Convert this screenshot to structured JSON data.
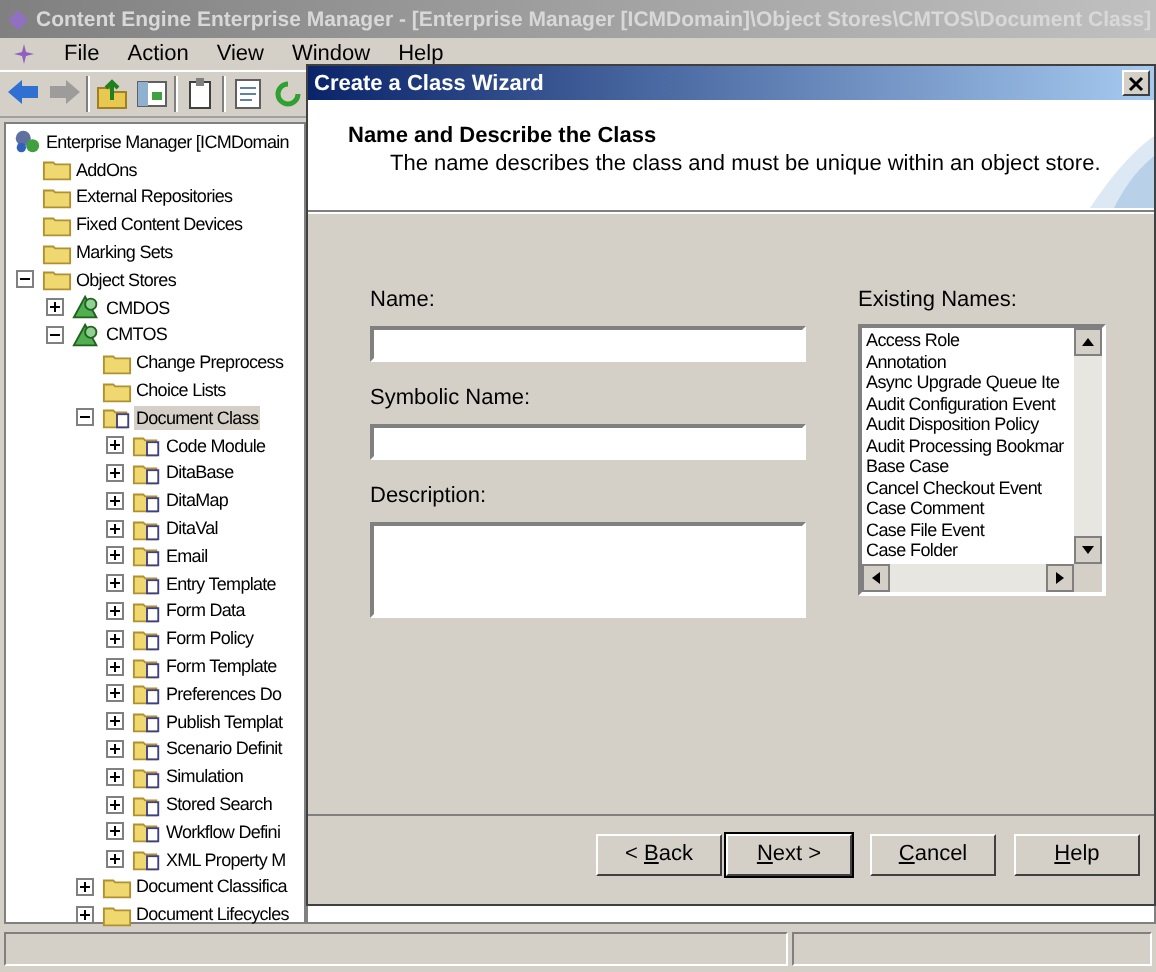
{
  "window": {
    "title": "Content Engine Enterprise Manager - [Enterprise Manager [ICMDomain]\\Object Stores\\CMTOS\\Document Class]"
  },
  "menu": [
    "File",
    "Action",
    "View",
    "Window",
    "Help"
  ],
  "toolbar": [
    {
      "kind": "back",
      "disabled": false
    },
    {
      "kind": "forward",
      "disabled": true
    },
    {
      "kind": "sep"
    },
    {
      "kind": "up",
      "disabled": false
    },
    {
      "kind": "view",
      "disabled": false
    },
    {
      "kind": "sep"
    },
    {
      "kind": "clipboard",
      "disabled": false
    },
    {
      "kind": "sep"
    },
    {
      "kind": "document",
      "disabled": false
    },
    {
      "kind": "refresh",
      "disabled": false
    }
  ],
  "tree": {
    "label": "Enterprise Manager [ICMDomain",
    "kind": "root",
    "selected": false,
    "children": [
      {
        "label": "AddOns",
        "kind": "folder",
        "selected": false
      },
      {
        "label": "External Repositories",
        "kind": "folder",
        "selected": false
      },
      {
        "label": "Fixed Content Devices",
        "kind": "folder",
        "selected": false
      },
      {
        "label": "Marking Sets",
        "kind": "folder",
        "selected": false
      },
      {
        "label": "Object Stores",
        "kind": "folder",
        "selected": false,
        "expanded": true,
        "children": [
          {
            "label": "CMDOS",
            "kind": "store",
            "selected": false,
            "expanded": false
          },
          {
            "label": "CMTOS",
            "kind": "store",
            "selected": false,
            "expanded": true,
            "children": [
              {
                "label": "Change Preprocess",
                "kind": "folder",
                "selected": false
              },
              {
                "label": "Choice Lists",
                "kind": "folder",
                "selected": false
              },
              {
                "label": "Document Class",
                "kind": "class",
                "selected": true,
                "expanded": true,
                "children": [
                  {
                    "label": "Code Module",
                    "kind": "class",
                    "selected": false,
                    "expanded": false
                  },
                  {
                    "label": "DitaBase",
                    "kind": "class",
                    "selected": false,
                    "expanded": false
                  },
                  {
                    "label": "DitaMap",
                    "kind": "class",
                    "selected": false,
                    "expanded": false
                  },
                  {
                    "label": "DitaVal",
                    "kind": "class",
                    "selected": false,
                    "expanded": false
                  },
                  {
                    "label": "Email",
                    "kind": "class",
                    "selected": false,
                    "expanded": false
                  },
                  {
                    "label": "Entry Template",
                    "kind": "class",
                    "selected": false,
                    "expanded": false
                  },
                  {
                    "label": "Form Data",
                    "kind": "class",
                    "selected": false,
                    "expanded": false
                  },
                  {
                    "label": "Form Policy",
                    "kind": "class",
                    "selected": false,
                    "expanded": false
                  },
                  {
                    "label": "Form Template",
                    "kind": "class",
                    "selected": false,
                    "expanded": false
                  },
                  {
                    "label": "Preferences Do",
                    "kind": "class",
                    "selected": false,
                    "expanded": false
                  },
                  {
                    "label": "Publish Templat",
                    "kind": "class",
                    "selected": false,
                    "expanded": false
                  },
                  {
                    "label": "Scenario Definit",
                    "kind": "class",
                    "selected": false,
                    "expanded": false
                  },
                  {
                    "label": "Simulation",
                    "kind": "class",
                    "selected": false,
                    "expanded": false
                  },
                  {
                    "label": "Stored Search",
                    "kind": "class",
                    "selected": false,
                    "expanded": false
                  },
                  {
                    "label": "Workflow Defini",
                    "kind": "class",
                    "selected": false,
                    "expanded": false
                  },
                  {
                    "label": "XML Property M",
                    "kind": "class",
                    "selected": false,
                    "expanded": false
                  }
                ]
              },
              {
                "label": "Document Classifica",
                "kind": "folder",
                "selected": false,
                "expanded": false
              },
              {
                "label": "Document Lifecycles",
                "kind": "folder",
                "selected": false,
                "expanded": false
              }
            ]
          }
        ]
      }
    ]
  },
  "dialog": {
    "title": "Create a Class Wizard",
    "heading": "Name and Describe the Class",
    "subheading": "The name describes the class and must be unique within an object store.",
    "fields": [
      {
        "label": "Name:",
        "kind": "line"
      },
      {
        "label": "Symbolic Name:",
        "kind": "line"
      },
      {
        "label": "Description:",
        "kind": "area"
      }
    ],
    "existing_names": {
      "label": "Existing Names:",
      "items": [
        "Access Role",
        "Annotation",
        "Async Upgrade Queue Ite",
        "Audit Configuration Event",
        "Audit Disposition Policy",
        "Audit Processing Bookmar",
        "Base Case",
        "Cancel Checkout Event",
        "Case Comment",
        "Case File Event",
        "Case Folder"
      ]
    },
    "buttons": [
      {
        "before": "< ",
        "key": "B",
        "after": "ack",
        "default": false
      },
      {
        "key": "N",
        "after": "ext >",
        "default": true
      },
      {
        "key": "C",
        "after": "ancel",
        "default": false
      },
      {
        "key": "H",
        "after": "elp",
        "default": false
      }
    ]
  }
}
